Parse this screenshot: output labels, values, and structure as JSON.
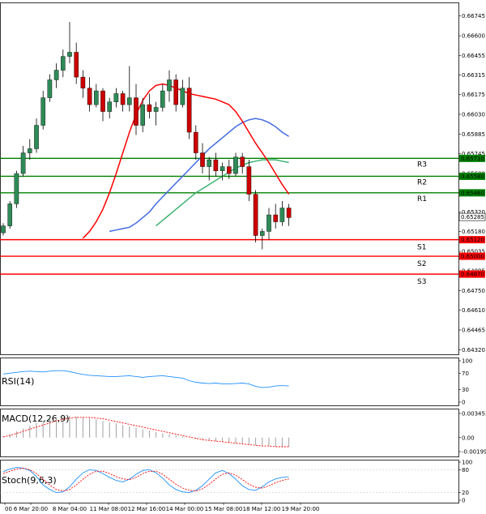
{
  "chart_data": {
    "type": "candlestick",
    "colors": {
      "bull": "#2e8b57",
      "bear": "#cc0000",
      "ema_fast": "#ff0000",
      "ema_mid": "#4169e1",
      "ema_slow": "#3cb371",
      "resistance": "#008000",
      "support": "#ff0000",
      "rsi": "#1e90ff",
      "macd_hist": "#a0a0a0",
      "macd_signal": "#ff0000",
      "stoch_k": "#1e90ff",
      "stoch_d": "#ff0000"
    },
    "price_axis": {
      "ticks": [
        "0.66745",
        "0.66600",
        "0.66455",
        "0.66315",
        "0.66175",
        "0.66030",
        "0.65885",
        "0.65745",
        "0.65600",
        "0.65460",
        "0.65320",
        "0.65180",
        "0.65035",
        "0.64895",
        "0.64750",
        "0.64610",
        "0.64465",
        "0.64320"
      ],
      "ylim": [
        0.643,
        0.6683
      ]
    },
    "time_axis": {
      "labels": [
        "00",
        "6 Mar 20:00",
        "8 Mar 04:00",
        "11 Mar 08:00",
        "12 Mar 16:00",
        "14 Mar 00:00",
        "15 Mar 08:00",
        "18 Mar 12:00",
        "19 Mar 20:00"
      ]
    },
    "current_price": "0.65285",
    "levels": [
      {
        "name": "R3",
        "value": 0.6571,
        "tag": "0.65710",
        "kind": "resistance"
      },
      {
        "name": "R2",
        "value": 0.6558,
        "tag": "0.65580",
        "kind": "resistance"
      },
      {
        "name": "R1",
        "value": 0.6546,
        "tag": "0.65460",
        "kind": "resistance"
      },
      {
        "name": "S1",
        "value": 0.6512,
        "tag": "0.65120",
        "kind": "support"
      },
      {
        "name": "S2",
        "value": 0.65,
        "tag": "0.65000",
        "kind": "support"
      },
      {
        "name": "S3",
        "value": 0.6487,
        "tag": "0.64870",
        "kind": "support"
      }
    ],
    "candles": [
      [
        0.6517,
        0.6524,
        0.6515,
        0.6522
      ],
      [
        0.6522,
        0.654,
        0.652,
        0.6538
      ],
      [
        0.6538,
        0.6562,
        0.6535,
        0.656
      ],
      [
        0.656,
        0.658,
        0.6558,
        0.6575
      ],
      [
        0.6575,
        0.6585,
        0.657,
        0.6578
      ],
      [
        0.6578,
        0.66,
        0.6575,
        0.6595
      ],
      [
        0.6595,
        0.662,
        0.6592,
        0.6615
      ],
      [
        0.6615,
        0.6632,
        0.6612,
        0.6628
      ],
      [
        0.6628,
        0.664,
        0.6622,
        0.6635
      ],
      [
        0.6635,
        0.665,
        0.663,
        0.6645
      ],
      [
        0.6645,
        0.667,
        0.664,
        0.6648
      ],
      [
        0.6648,
        0.6655,
        0.6625,
        0.663
      ],
      [
        0.663,
        0.6635,
        0.6615,
        0.6622
      ],
      [
        0.6622,
        0.663,
        0.6605,
        0.661
      ],
      [
        0.661,
        0.6625,
        0.6608,
        0.662
      ],
      [
        0.662,
        0.6622,
        0.6598,
        0.6605
      ],
      [
        0.6605,
        0.6615,
        0.66,
        0.6612
      ],
      [
        0.6612,
        0.6622,
        0.6608,
        0.6618
      ],
      [
        0.6618,
        0.662,
        0.6605,
        0.661
      ],
      [
        0.661,
        0.6638,
        0.6605,
        0.6615
      ],
      [
        0.6615,
        0.6625,
        0.6588,
        0.6595
      ],
      [
        0.6595,
        0.6615,
        0.659,
        0.661
      ],
      [
        0.661,
        0.6618,
        0.66,
        0.6605
      ],
      [
        0.6605,
        0.6612,
        0.6595,
        0.6608
      ],
      [
        0.6608,
        0.6625,
        0.6605,
        0.662
      ],
      [
        0.662,
        0.6635,
        0.6612,
        0.6628
      ],
      [
        0.6628,
        0.6632,
        0.6605,
        0.661
      ],
      [
        0.661,
        0.6628,
        0.6608,
        0.6622
      ],
      [
        0.6622,
        0.663,
        0.6585,
        0.659
      ],
      [
        0.659,
        0.6595,
        0.657,
        0.6575
      ],
      [
        0.6575,
        0.6582,
        0.656,
        0.6565
      ],
      [
        0.6565,
        0.6572,
        0.6555,
        0.657
      ],
      [
        0.657,
        0.6575,
        0.6558,
        0.6562
      ],
      [
        0.6562,
        0.6568,
        0.6555,
        0.6565
      ],
      [
        0.6565,
        0.657,
        0.6556,
        0.656
      ],
      [
        0.656,
        0.6575,
        0.6558,
        0.6572
      ],
      [
        0.6572,
        0.6575,
        0.656,
        0.6565
      ],
      [
        0.6565,
        0.657,
        0.654,
        0.6545
      ],
      [
        0.6545,
        0.6548,
        0.651,
        0.6515
      ],
      [
        0.6515,
        0.652,
        0.6505,
        0.6518
      ],
      [
        0.6518,
        0.6535,
        0.6512,
        0.653
      ],
      [
        0.653,
        0.6538,
        0.652,
        0.6525
      ],
      [
        0.6525,
        0.654,
        0.6522,
        0.6535
      ],
      [
        0.6535,
        0.6538,
        0.6522,
        0.6528
      ]
    ],
    "ema_fast": [
      0.6513,
      0.6518,
      0.6525,
      0.6534,
      0.6546,
      0.656,
      0.6575,
      0.659,
      0.6603,
      0.6613,
      0.662,
      0.6624,
      0.6625,
      0.6624,
      0.6622,
      0.662,
      0.6618,
      0.6617,
      0.6616,
      0.6615,
      0.6614,
      0.6612,
      0.661,
      0.6605,
      0.6598,
      0.659,
      0.6582,
      0.6575,
      0.6568,
      0.656,
      0.6552,
      0.6545
    ],
    "ema_mid": [
      0.6518,
      0.6519,
      0.652,
      0.6521,
      0.6524,
      0.6528,
      0.6532,
      0.6538,
      0.6543,
      0.6548,
      0.6553,
      0.6558,
      0.6563,
      0.6568,
      0.6573,
      0.6578,
      0.6582,
      0.6586,
      0.659,
      0.6594,
      0.6597,
      0.6599,
      0.66,
      0.6599,
      0.6597,
      0.6594,
      0.659,
      0.6587
    ],
    "ema_slow": [
      0.6522,
      0.6526,
      0.653,
      0.6534,
      0.6538,
      0.6542,
      0.6546,
      0.6549,
      0.6552,
      0.6555,
      0.6558,
      0.6561,
      0.6564,
      0.6566,
      0.6568,
      0.6569,
      0.657,
      0.657,
      0.657,
      0.6569,
      0.6568
    ],
    "rsi": {
      "title": "RSI(14)",
      "ticks": [
        "100",
        "70",
        "30",
        "0"
      ],
      "values": [
        68,
        70,
        72,
        74,
        75,
        74,
        73,
        75,
        76,
        76,
        74,
        70,
        67,
        65,
        64,
        63,
        62,
        62,
        63,
        64,
        62,
        60,
        62,
        63,
        64,
        62,
        60,
        58,
        52,
        48,
        46,
        45,
        46,
        44,
        44,
        45,
        46,
        44,
        38,
        35,
        36,
        39,
        40,
        39
      ]
    },
    "macd": {
      "title": "MACD(12,26,9)",
      "ticks": [
        "0.003453",
        "0.00",
        "-0.001999"
      ],
      "hist": [
        0.0002,
        0.0005,
        0.0009,
        0.0013,
        0.0017,
        0.0021,
        0.0024,
        0.0027,
        0.0029,
        0.003,
        0.0031,
        0.003,
        0.0029,
        0.0028,
        0.0026,
        0.0024,
        0.0022,
        0.002,
        0.0018,
        0.0016,
        0.0014,
        0.0012,
        0.001,
        0.0008,
        0.0006,
        0.0005,
        0.0003,
        0.0002,
        0.0,
        -0.0002,
        -0.0003,
        -0.0004,
        -0.0005,
        -0.0006,
        -0.0007,
        -0.0008,
        -0.0009,
        -0.001,
        -0.0011,
        -0.0012,
        -0.0012,
        -0.0013,
        -0.0013,
        -0.0013
      ],
      "signal": [
        0.0001,
        0.0003,
        0.0006,
        0.0009,
        0.0012,
        0.0015,
        0.0018,
        0.0021,
        0.0024,
        0.0026,
        0.0028,
        0.0029,
        0.0029,
        0.0029,
        0.0028,
        0.0027,
        0.0025,
        0.0023,
        0.0021,
        0.0019,
        0.0017,
        0.0015,
        0.0013,
        0.0011,
        0.0009,
        0.0007,
        0.0005,
        0.0003,
        0.0001,
        -0.0001,
        -0.0003,
        -0.0004,
        -0.0005,
        -0.0006,
        -0.0007,
        -0.0008,
        -0.0009,
        -0.001,
        -0.0011,
        -0.0012,
        -0.0012,
        -0.0013,
        -0.0013,
        -0.0013
      ]
    },
    "stoch": {
      "title": "Stoch(9,6,3)",
      "ticks": [
        "100",
        "80",
        "20",
        "0"
      ],
      "k": [
        75,
        82,
        86,
        84,
        78,
        62,
        40,
        28,
        20,
        22,
        35,
        55,
        72,
        80,
        78,
        70,
        60,
        52,
        48,
        55,
        68,
        78,
        80,
        72,
        58,
        40,
        28,
        22,
        20,
        26,
        38,
        55,
        72,
        78,
        70,
        55,
        38,
        28,
        26,
        35,
        48,
        56,
        60,
        62
      ],
      "d": [
        70,
        76,
        82,
        84,
        80,
        70,
        55,
        40,
        28,
        24,
        28,
        40,
        55,
        68,
        76,
        76,
        70,
        62,
        56,
        54,
        60,
        70,
        76,
        76,
        68,
        55,
        42,
        32,
        26,
        24,
        30,
        42,
        56,
        68,
        72,
        66,
        54,
        42,
        34,
        32,
        38,
        46,
        52,
        56
      ]
    }
  }
}
